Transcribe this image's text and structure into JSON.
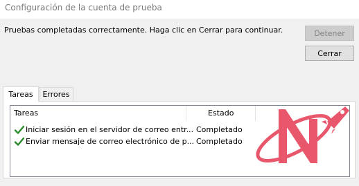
{
  "window": {
    "title": "Configuración de la cuenta de prueba"
  },
  "status": {
    "message": "Pruebas completadas correctamente. Haga clic en Cerrar para continuar."
  },
  "buttons": {
    "stop_label": "Detener",
    "close_label": "Cerrar"
  },
  "tabs": [
    {
      "label": "Tareas",
      "active": true
    },
    {
      "label": "Errores",
      "active": false
    }
  ],
  "task_list": {
    "columns": [
      "Tareas",
      "Estado"
    ],
    "rows": [
      {
        "icon": "checkmark-icon",
        "task": "Iniciar sesión en el servidor de correo entr...",
        "status": "Completado"
      },
      {
        "icon": "checkmark-icon",
        "task": "Enviar mensaje de correo electrónico de p...",
        "status": "Completado"
      }
    ]
  },
  "colors": {
    "check_green": "#2b8a2b",
    "logo_red": "#e8576c"
  }
}
